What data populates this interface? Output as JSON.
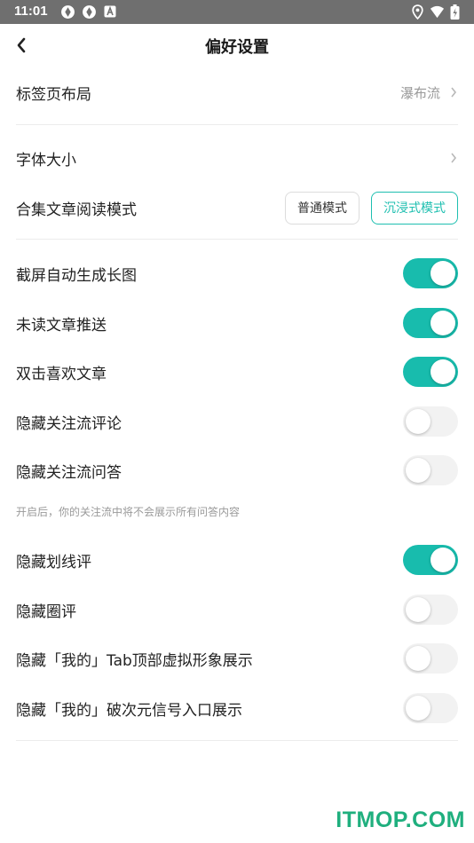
{
  "status_bar": {
    "time": "11:01",
    "icons": [
      "notification-icon",
      "notification-icon",
      "app-icon",
      "location-icon",
      "wifi-icon",
      "battery-icon"
    ]
  },
  "header": {
    "title": "偏好设置",
    "back_icon": "chevron-left-icon"
  },
  "settings": {
    "tab_layout": {
      "label": "标签页布局",
      "value": "瀑布流"
    },
    "font_size": {
      "label": "字体大小"
    },
    "collection_mode": {
      "label": "合集文章阅读模式",
      "options": [
        "普通模式",
        "沉浸式模式"
      ],
      "selected": "沉浸式模式"
    },
    "toggles": [
      {
        "label": "截屏自动生成长图",
        "on": true
      },
      {
        "label": "未读文章推送",
        "on": true
      },
      {
        "label": "双击喜欢文章",
        "on": true
      },
      {
        "label": "隐藏关注流评论",
        "on": false
      },
      {
        "label": "隐藏关注流问答",
        "on": false
      },
      {
        "label": "隐藏划线评",
        "on": true
      },
      {
        "label": "隐藏圈评",
        "on": false
      },
      {
        "label": "隐藏「我的」Tab顶部虚拟形象展示",
        "on": false
      },
      {
        "label": "隐藏「我的」破次元信号入口展示",
        "on": false
      }
    ],
    "qa_hint": "开启后，你的关注流中将不会展示所有问答内容"
  },
  "colors": {
    "accent": "#18bcad",
    "status_bar": "#6f6f6f",
    "watermark": "#1faf7e"
  },
  "watermark": "ITMOP.COM"
}
